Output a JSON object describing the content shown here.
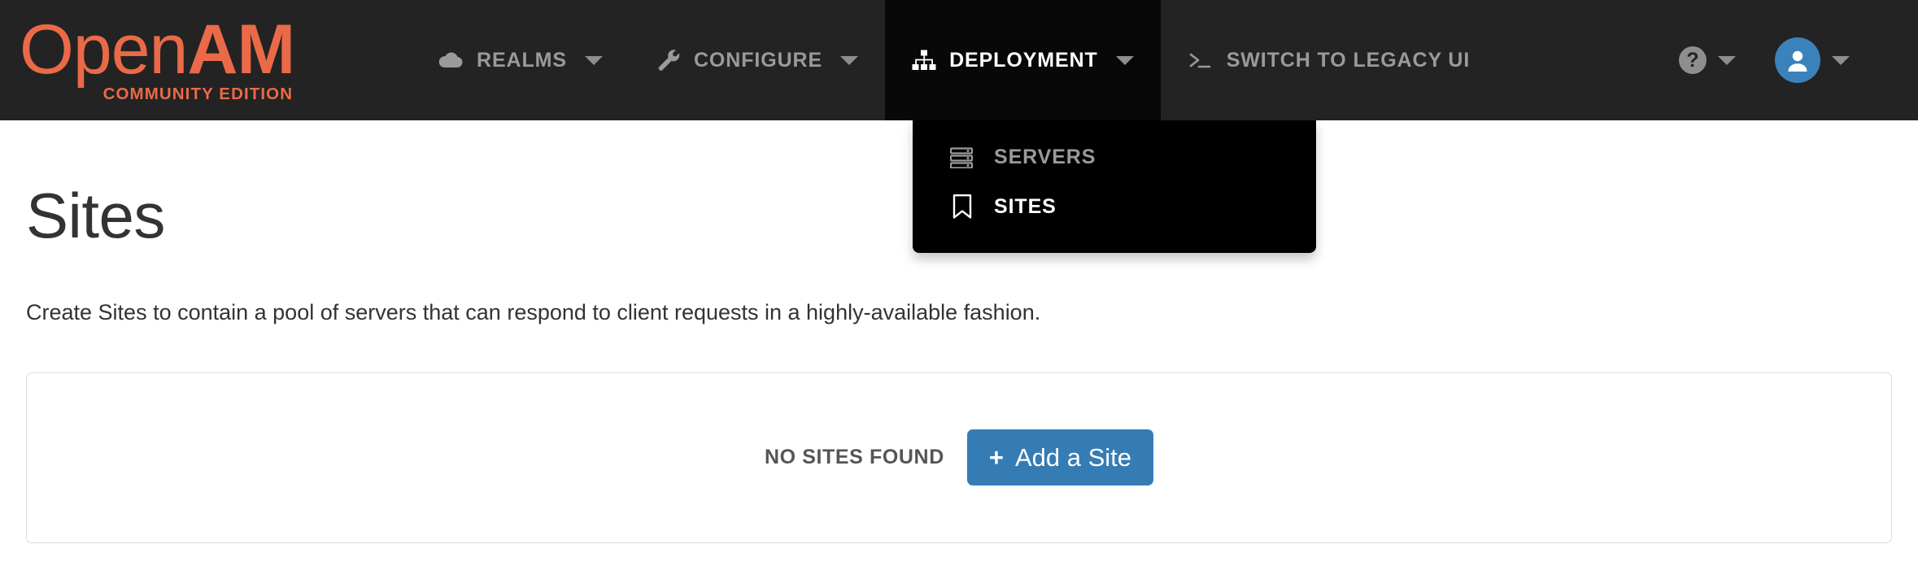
{
  "brand": {
    "name_light": "Open",
    "name_bold": "AM",
    "subtitle": "COMMUNITY EDITION",
    "color": "#ea6a48"
  },
  "navbar": {
    "background": "#232323",
    "active_background": "#080808",
    "text_color": "#9a9a9a",
    "items": [
      {
        "label": "REALMS",
        "icon": "cloud-icon",
        "has_caret": true,
        "active": false
      },
      {
        "label": "CONFIGURE",
        "icon": "wrench-icon",
        "has_caret": true,
        "active": false
      },
      {
        "label": "DEPLOYMENT",
        "icon": "sitemap-icon",
        "has_caret": true,
        "active": true
      },
      {
        "label": "SWITCH TO LEGACY UI",
        "icon": "terminal-icon",
        "has_caret": false,
        "active": false
      }
    ],
    "help": {
      "glyph": "?",
      "icon": "help-circle-icon"
    },
    "user": {
      "icon": "user-avatar-icon",
      "color": "#3b82bc"
    }
  },
  "dropdown": {
    "background": "#000000",
    "items": [
      {
        "label": "SERVERS",
        "icon": "server-stack-icon",
        "active": false
      },
      {
        "label": "SITES",
        "icon": "bookmark-icon",
        "active": true
      }
    ]
  },
  "main": {
    "title": "Sites",
    "description": "Create Sites to contain a pool of servers that can respond to client requests in a highly-available fashion.",
    "panel": {
      "empty_label": "NO SITES FOUND",
      "add_button": {
        "label": "Add a Site",
        "icon": "plus-icon",
        "plus_glyph": "+",
        "color": "#357cb4"
      }
    }
  }
}
